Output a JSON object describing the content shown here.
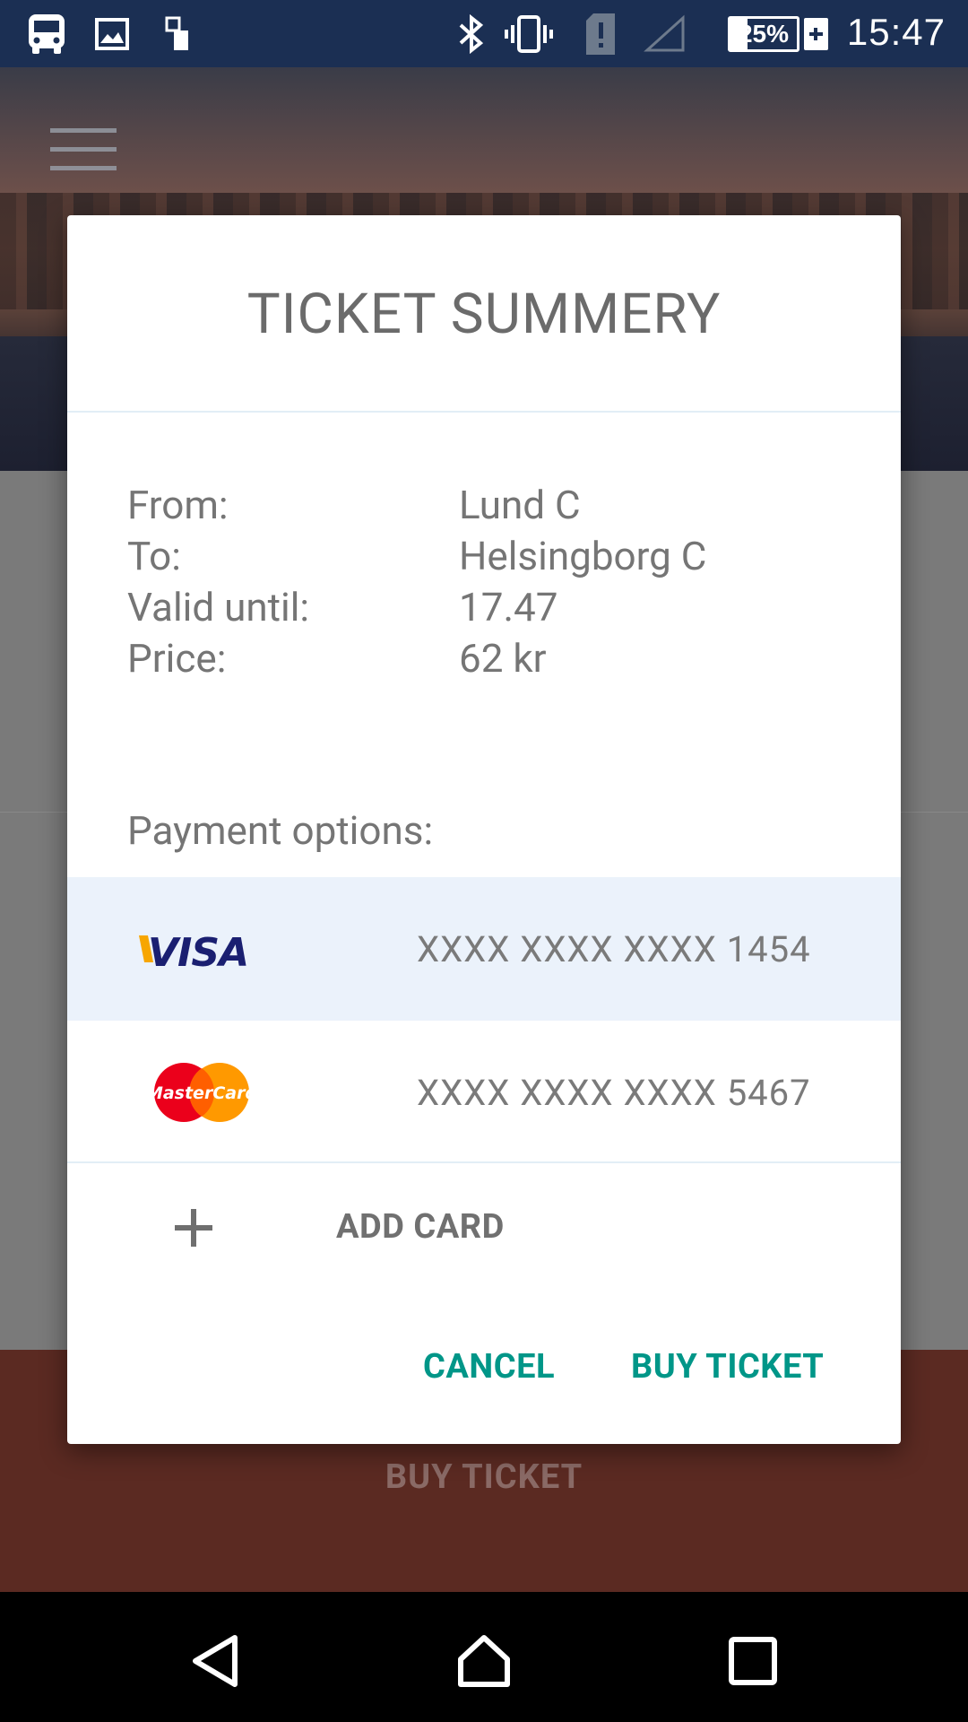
{
  "status_bar": {
    "icons": [
      "bus-icon",
      "image-icon",
      "sim-swap-icon",
      "bluetooth-icon",
      "vibrate-icon",
      "sim-alert-icon",
      "signal-icon"
    ],
    "battery_percent": 25,
    "battery_text": "25%",
    "time": "15:47"
  },
  "background": {
    "menu_icon": "hamburger-menu-icon",
    "buy_ticket_label": "BUY TICKET"
  },
  "dialog": {
    "title": "TICKET SUMMERY",
    "details": [
      {
        "label": "From:",
        "value": "Lund C"
      },
      {
        "label": "To:",
        "value": "Helsingborg C"
      },
      {
        "label": "Valid until:",
        "value": "17.47"
      },
      {
        "label": "Price:",
        "value": "62 kr"
      }
    ],
    "payment_heading": "Payment options:",
    "cards": [
      {
        "brand": "VISA",
        "number": "XXXX XXXX XXXX 1454",
        "selected": true
      },
      {
        "brand": "MasterCard",
        "number": "XXXX XXXX XXXX 5467",
        "selected": false
      }
    ],
    "add_card_label": "ADD CARD",
    "cancel_label": "CANCEL",
    "buy_label": "BUY TICKET"
  },
  "colors": {
    "status_bar": "#1b2f53",
    "accent": "#009688",
    "selected_row": "#ebf2fb",
    "visa_blue": "#1a1f71",
    "visa_gold": "#f7a600",
    "mastercard_red": "#eb001b",
    "mastercard_orange": "#ff9900"
  },
  "nav_bar": {
    "icons": [
      "back-icon",
      "home-icon",
      "recents-icon"
    ]
  }
}
